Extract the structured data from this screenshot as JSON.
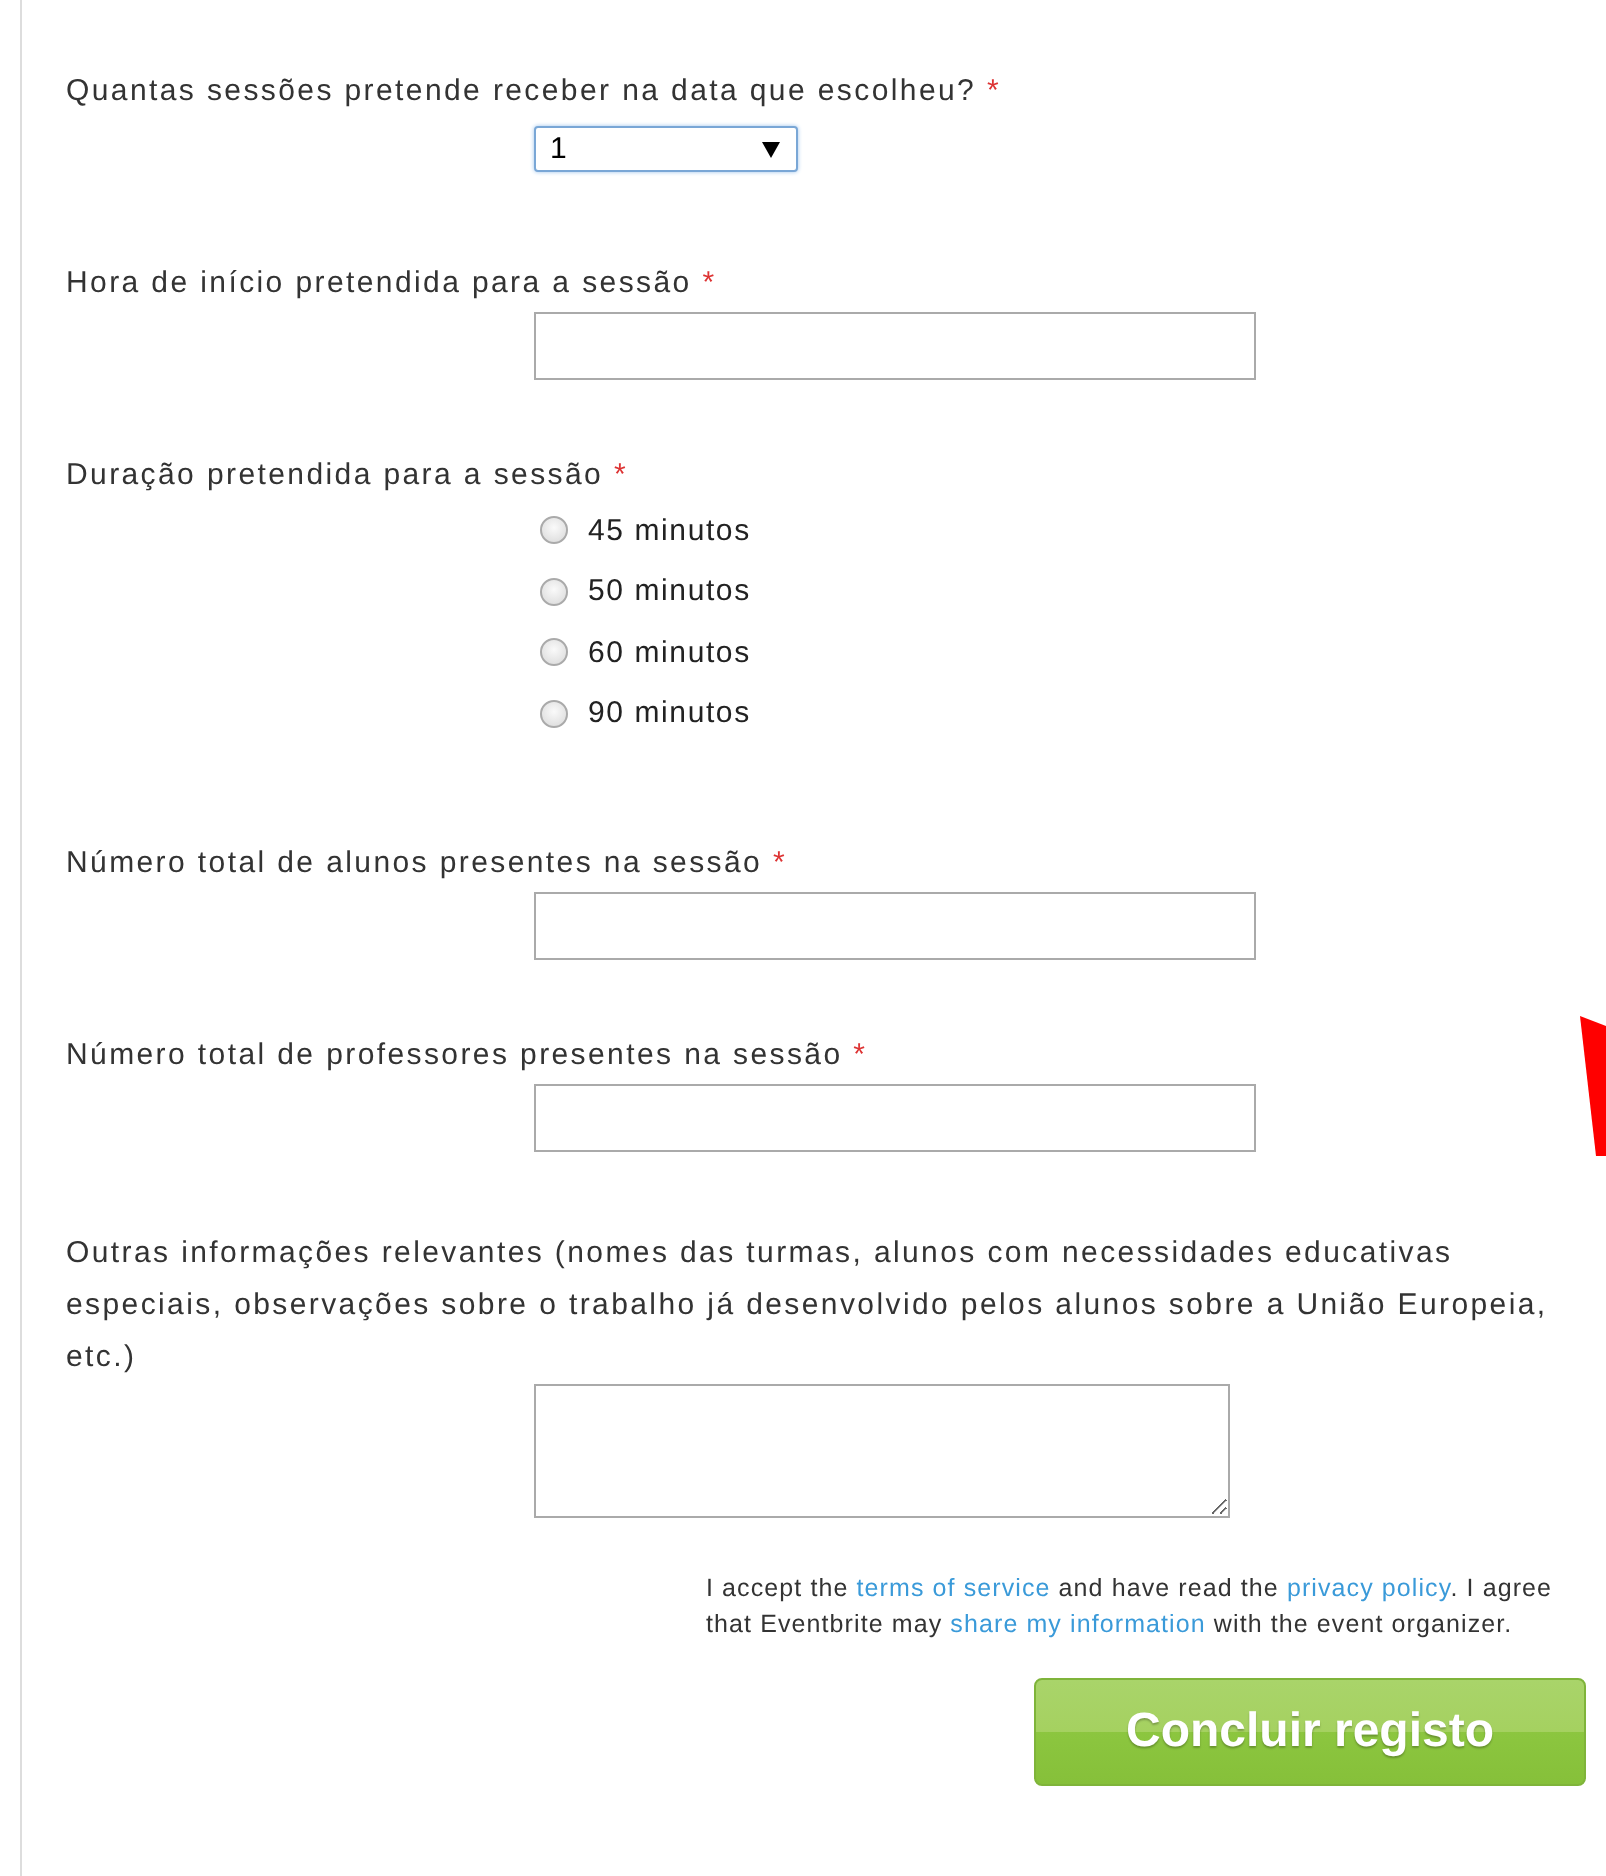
{
  "fields": [
    {
      "kind": "select",
      "label": "Quantas sessões pretende receber na data que escolheu?",
      "required_mark": "*",
      "value": "1"
    },
    {
      "kind": "text",
      "label": "Hora de início pretendida para a sessão",
      "required_mark": "*"
    },
    {
      "kind": "radio",
      "label": "Duração pretendida para a sessão",
      "required_mark": "*",
      "options": [
        {
          "label": "45 minutos",
          "selected": false
        },
        {
          "label": "50 minutos",
          "selected": false
        },
        {
          "label": "60 minutos",
          "selected": false
        },
        {
          "label": "90 minutos",
          "selected": false
        }
      ]
    },
    {
      "kind": "text",
      "label": "Número total de alunos presentes na sessão",
      "required_mark": "*"
    },
    {
      "kind": "text",
      "label": "Número total de professores presentes na sessão",
      "required_mark": "*"
    },
    {
      "kind": "textarea",
      "label": "Outras informações relevantes (nomes das turmas, alunos com necessidades educativas especiais, observações sobre o trabalho já desenvolvido pelos alunos sobre a União Europeia, etc.)"
    }
  ],
  "consent": [
    {
      "text": "I accept the "
    },
    {
      "text": "terms of service",
      "link": true
    },
    {
      "text": " and have read the "
    },
    {
      "text": "privacy policy",
      "link": true
    },
    {
      "text": ". I agree that Eventbrite may "
    },
    {
      "text": "share my information",
      "link": true
    },
    {
      "text": " with the event organizer."
    }
  ],
  "submit": "Concluir registo"
}
